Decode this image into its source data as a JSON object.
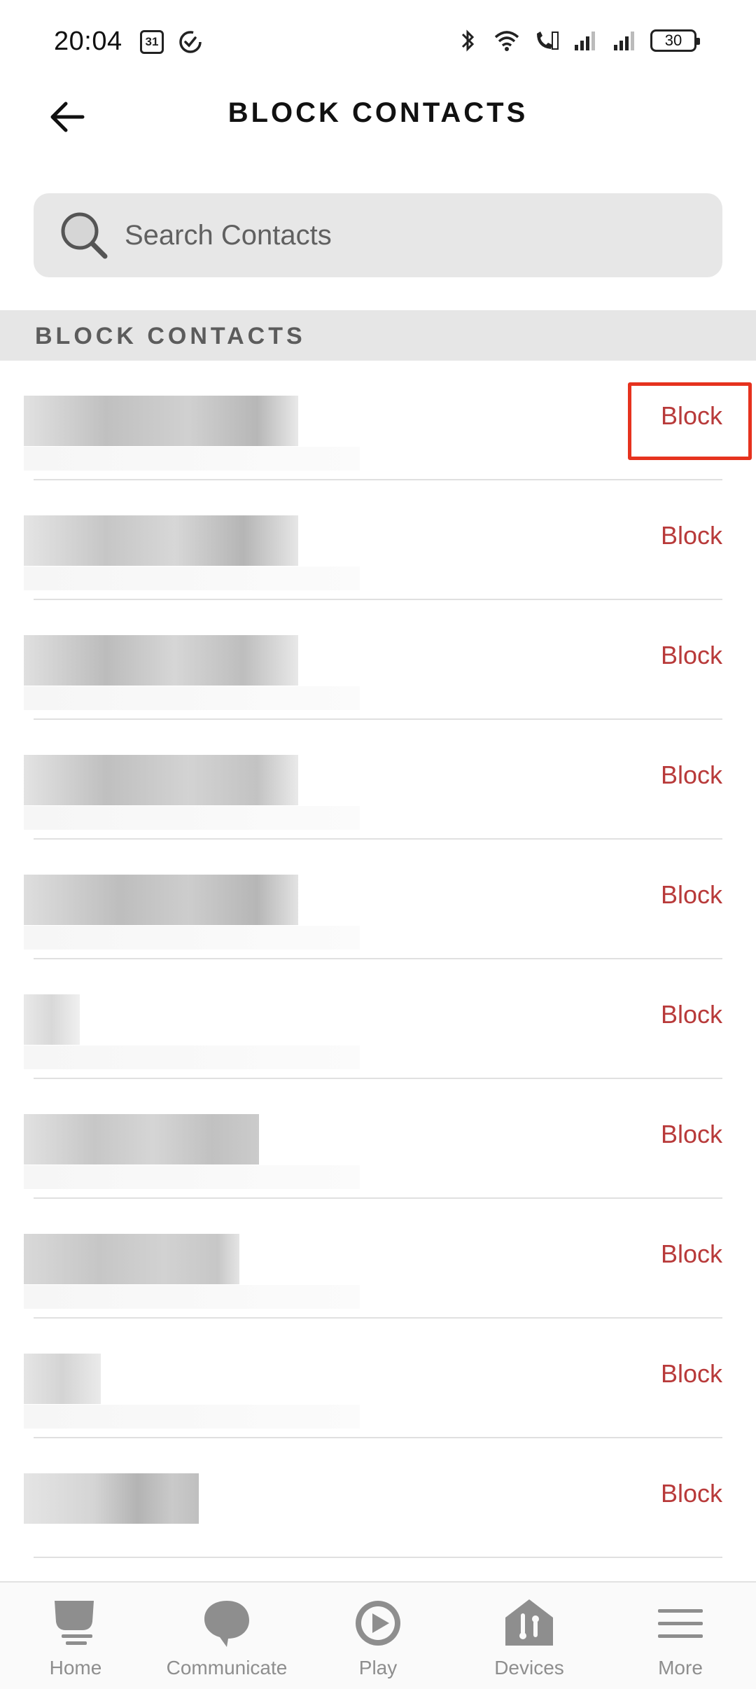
{
  "status_bar": {
    "time": "20:04",
    "calendar_day": "31",
    "battery": "30"
  },
  "header": {
    "title": "BLOCK CONTACTS",
    "back_icon": "arrow-left-icon"
  },
  "search": {
    "placeholder": "Search Contacts",
    "icon": "search-icon"
  },
  "section": {
    "title": "BLOCK CONTACTS"
  },
  "contacts": {
    "block_label": "Block",
    "rows": [
      {
        "action": "Block"
      },
      {
        "action": "Block"
      },
      {
        "action": "Block"
      },
      {
        "action": "Block"
      },
      {
        "action": "Block"
      },
      {
        "action": "Block"
      },
      {
        "action": "Block"
      },
      {
        "action": "Block"
      },
      {
        "action": "Block"
      },
      {
        "action": "Block"
      }
    ]
  },
  "highlight_color": "#e6321e",
  "accent_color": "#b83a3a",
  "bottom_nav": {
    "items": [
      {
        "label": "Home",
        "icon": "home-icon"
      },
      {
        "label": "Communicate",
        "icon": "chat-bubble-icon"
      },
      {
        "label": "Play",
        "icon": "play-icon"
      },
      {
        "label": "Devices",
        "icon": "devices-icon"
      },
      {
        "label": "More",
        "icon": "menu-icon"
      }
    ]
  }
}
